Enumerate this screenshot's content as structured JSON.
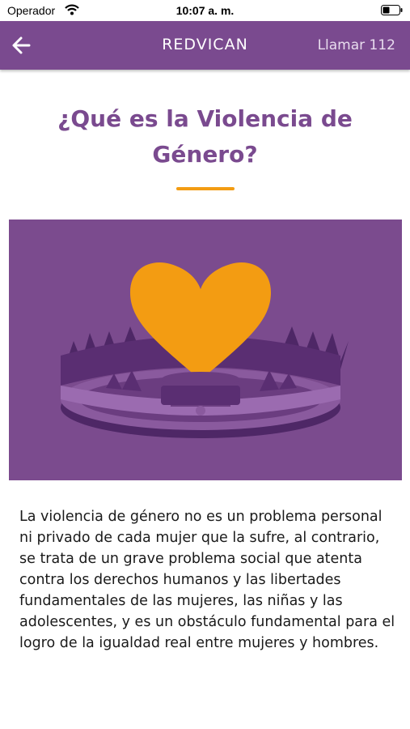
{
  "status_bar": {
    "carrier": "Operador",
    "time": "10:07 a. m."
  },
  "navbar": {
    "back_icon": "arrow-left-icon",
    "title": "REDVICAN",
    "call_label": "Llamar 112"
  },
  "article": {
    "title": "¿Qué es la Violencia de Género?",
    "body": "La violencia de género no es un problema personal ni privado de cada mujer que la sufre, al contrario, se trata de un grave problema social que atenta contra los derechos humanos y las libertades fundamentales de las mujeres, las niñas y las adolescentes, y es un obstáculo fundamental para el logro de la igualdad real entre mujeres y hombres."
  },
  "colors": {
    "brand_purple": "#7a4a8f",
    "accent_orange": "#f39c12"
  }
}
